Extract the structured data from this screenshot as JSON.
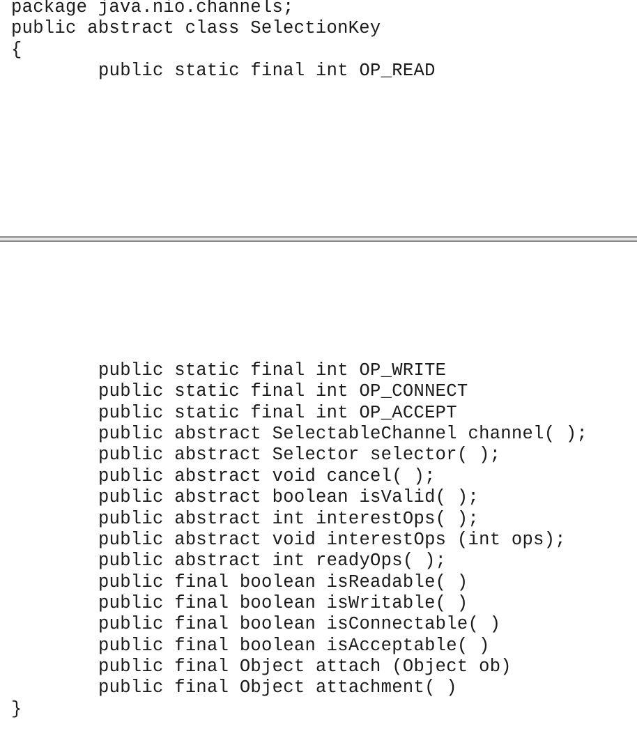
{
  "header": {
    "package_line": "package java.nio.channels;",
    "class_line": "public abstract class SelectionKey",
    "open_brace": "{",
    "first_member": "public static final int OP_READ"
  },
  "members": [
    "public static final int OP_WRITE",
    "public static final int OP_CONNECT",
    "public static final int OP_ACCEPT",
    "public abstract SelectableChannel channel( );",
    "public abstract Selector selector( );",
    "public abstract void cancel( );",
    "public abstract boolean isValid( );",
    "public abstract int interestOps( );",
    "public abstract void interestOps (int ops);",
    "public abstract int readyOps( );",
    "public final boolean isReadable( )",
    "public final boolean isWritable( )",
    "public final boolean isConnectable( )",
    "public final boolean isAcceptable( )",
    "public final Object attach (Object ob)",
    "public final Object attachment( )"
  ],
  "footer": {
    "close_brace": "}"
  }
}
